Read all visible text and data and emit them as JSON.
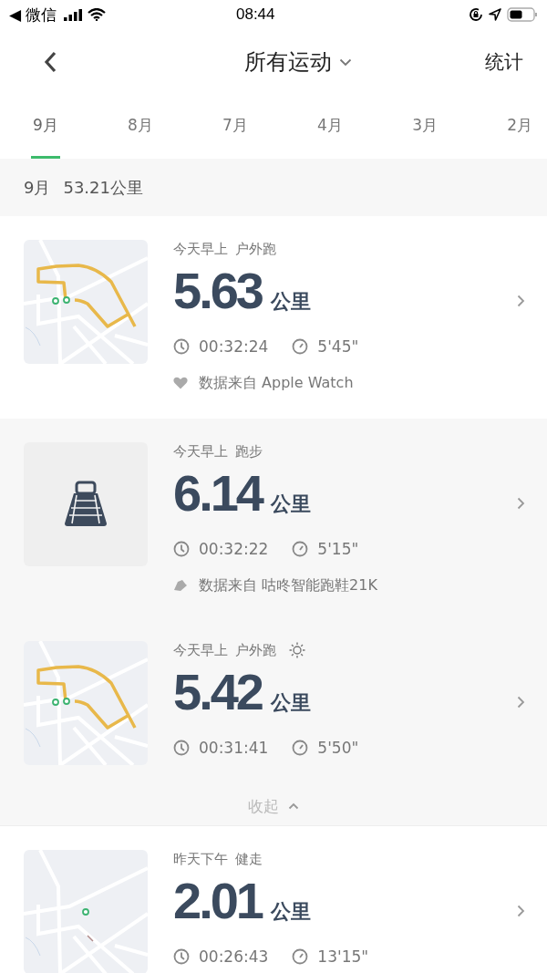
{
  "status_bar": {
    "back_app": "◀ 微信",
    "time": "08:44"
  },
  "nav": {
    "title": "所有运动",
    "action": "统计"
  },
  "month_tabs": [
    {
      "label": "9月",
      "selected": true
    },
    {
      "label": "8月",
      "selected": false
    },
    {
      "label": "7月",
      "selected": false
    },
    {
      "label": "4月",
      "selected": false
    },
    {
      "label": "3月",
      "selected": false
    },
    {
      "label": "2月",
      "selected": false
    }
  ],
  "summary": {
    "month": "9月",
    "distance": "53.21公里"
  },
  "activities": [
    {
      "thumbnail": {
        "kind": "route-map"
      },
      "when": "今天早上",
      "type": "户外跑",
      "sunny": false,
      "distance": "5.63",
      "unit": "公里",
      "duration": "00:32:24",
      "pace": "5'45\"",
      "source": {
        "kind": "heart",
        "text": "数据来自 Apple Watch"
      }
    }
  ],
  "merged_group": {
    "collapse_label": "收起",
    "activities": [
      {
        "thumbnail": {
          "kind": "treadmill"
        },
        "when": "今天早上",
        "type": "跑步",
        "sunny": false,
        "distance": "6.14",
        "unit": "公里",
        "duration": "00:32:22",
        "pace": "5'15\"",
        "source": {
          "kind": "shoe",
          "text": "数据来自 咕咚智能跑鞋21K"
        }
      },
      {
        "thumbnail": {
          "kind": "route-map"
        },
        "when": "今天早上",
        "type": "户外跑",
        "sunny": true,
        "distance": "5.42",
        "unit": "公里",
        "duration": "00:31:41",
        "pace": "5'50\""
      }
    ]
  },
  "more_activities": [
    {
      "thumbnail": {
        "kind": "start-map"
      },
      "when": "昨天下午",
      "type": "健走",
      "sunny": false,
      "distance": "2.01",
      "unit": "公里",
      "duration": "00:26:43",
      "pace": "13'15\""
    }
  ]
}
